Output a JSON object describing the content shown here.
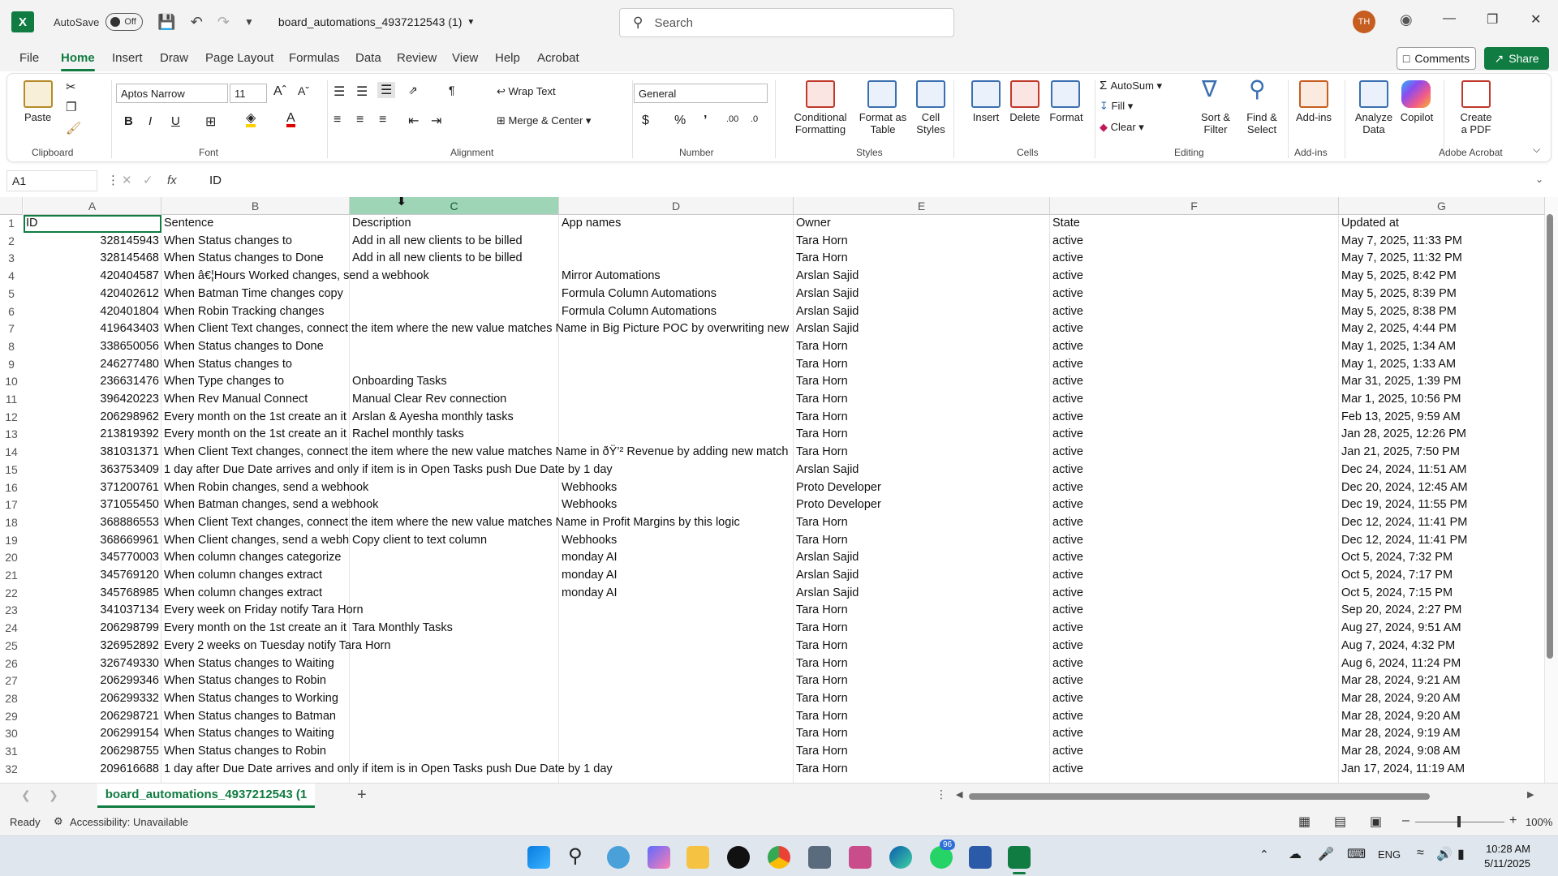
{
  "titlebar": {
    "app_icon": "excel-icon",
    "autosave_label": "AutoSave",
    "autosave_state": "Off",
    "file_title": "board_automations_4937212543 (1)",
    "search_placeholder": "Search",
    "avatar_initials": "TH"
  },
  "menu": {
    "tabs": [
      "File",
      "Home",
      "Insert",
      "Draw",
      "Page Layout",
      "Formulas",
      "Data",
      "Review",
      "View",
      "Help",
      "Acrobat"
    ],
    "active_tab": "Home",
    "comments_label": "Comments",
    "share_label": "Share"
  },
  "ribbon": {
    "clipboard": {
      "label": "Clipboard",
      "paste": "Paste"
    },
    "font": {
      "label": "Font",
      "family": "Aptos Narrow",
      "size": "11"
    },
    "alignment": {
      "label": "Alignment",
      "wrap_text": "Wrap Text",
      "merge_center": "Merge & Center"
    },
    "number": {
      "label": "Number",
      "format": "General"
    },
    "styles": {
      "label": "Styles",
      "conditional_1": "Conditional",
      "conditional_2": "Formatting",
      "format_as_1": "Format as",
      "format_as_2": "Table",
      "cell_styles_1": "Cell",
      "cell_styles_2": "Styles"
    },
    "cells": {
      "label": "Cells",
      "insert": "Insert",
      "delete": "Delete",
      "format": "Format"
    },
    "editing": {
      "label": "Editing",
      "autosum": "AutoSum",
      "fill": "Fill",
      "clear": "Clear",
      "sort_1": "Sort &",
      "sort_2": "Filter",
      "find_1": "Find &",
      "find_2": "Select"
    },
    "addins": {
      "label": "Add-ins",
      "addins": "Add-ins"
    },
    "analyze": {
      "analyze_1": "Analyze",
      "analyze_2": "Data",
      "copilot": "Copilot"
    },
    "acrobat": {
      "label": "Adobe Acrobat",
      "create_1": "Create",
      "create_2": "a PDF"
    }
  },
  "formula_bar": {
    "name_box": "A1",
    "fx": "fx",
    "content": "ID"
  },
  "columns": [
    "A",
    "B",
    "C",
    "D",
    "E",
    "F",
    "G"
  ],
  "rows": [
    [
      "ID",
      "Sentence",
      "Description",
      "App names",
      "Owner",
      "State",
      "Updated at"
    ],
    [
      "328145943",
      "When Status changes to",
      "Add in all new clients to be billed",
      "",
      "Tara Horn",
      "active",
      "May 7, 2025, 11:33 PM"
    ],
    [
      "328145468",
      "When Status changes to Done",
      "Add in all new clients to be billed",
      "",
      "Tara Horn",
      "active",
      "May 7, 2025, 11:32 PM"
    ],
    [
      "420404587",
      "When â€¦Hours Worked changes, send a webhook",
      "",
      "Mirror Automations",
      "Arslan Sajid",
      "active",
      "May 5, 2025, 8:42 PM"
    ],
    [
      "420402612",
      "When Batman Time changes copy",
      "",
      "Formula Column Automations",
      "Arslan Sajid",
      "active",
      "May 5, 2025, 8:39 PM"
    ],
    [
      "420401804",
      "When Robin Tracking changes",
      "",
      "Formula Column Automations",
      "Arslan Sajid",
      "active",
      "May 5, 2025, 8:38 PM"
    ],
    [
      "419643403",
      "When Client Text changes, connect the item where the new value matches Name in Big Picture POC by overwriting new",
      "",
      "",
      "Arslan Sajid",
      "active",
      "May 2, 2025, 4:44 PM"
    ],
    [
      "338650056",
      "When Status changes to Done",
      "",
      "",
      "Tara Horn",
      "active",
      "May 1, 2025, 1:34 AM"
    ],
    [
      "246277480",
      "When Status changes to",
      "",
      "",
      "Tara Horn",
      "active",
      "May 1, 2025, 1:33 AM"
    ],
    [
      "236631476",
      "When Type changes to",
      "Onboarding Tasks",
      "",
      "Tara Horn",
      "active",
      "Mar 31, 2025, 1:39 PM"
    ],
    [
      "396420223",
      "When Rev Manual Connect",
      "Manual Clear Rev connection",
      "",
      "Tara Horn",
      "active",
      "Mar 1, 2025, 10:56 PM"
    ],
    [
      "206298962",
      "Every month on the 1st create an it",
      "Arslan & Ayesha monthly tasks",
      "",
      "Tara Horn",
      "active",
      "Feb 13, 2025, 9:59 AM"
    ],
    [
      "213819392",
      "Every month on the 1st create an it",
      "Rachel monthly tasks",
      "",
      "Tara Horn",
      "active",
      "Jan 28, 2025, 12:26 PM"
    ],
    [
      "381031371",
      "When Client Text changes, connect the item where the new value matches Name in ðŸ’² Revenue by adding new match",
      "",
      "",
      "Tara Horn",
      "active",
      "Jan 21, 2025, 7:50 PM"
    ],
    [
      "363753409",
      "1 day after Due Date arrives and only if item is in Open Tasks push Due Date by 1 day",
      "",
      "",
      "Arslan Sajid",
      "active",
      "Dec 24, 2024, 11:51 AM"
    ],
    [
      "371200761",
      "When Robin changes, send a webhook",
      "",
      "Webhooks",
      "Proto Developer",
      "active",
      "Dec 20, 2024, 12:45 AM"
    ],
    [
      "371055450",
      "When Batman changes, send a webhook",
      "",
      "Webhooks",
      "Proto Developer",
      "active",
      "Dec 19, 2024, 11:55 PM"
    ],
    [
      "368886553",
      "When Client Text changes, connect the item where the new value matches Name in Profit Margins by this logic",
      "",
      "",
      "Tara Horn",
      "active",
      "Dec 12, 2024, 11:41 PM"
    ],
    [
      "368669961",
      "When Client changes, send a webh",
      "Copy client to text column",
      "Webhooks",
      "Tara Horn",
      "active",
      "Dec 12, 2024, 11:41 PM"
    ],
    [
      "345770003",
      "When column changes categorize",
      "",
      "monday AI",
      "Arslan Sajid",
      "active",
      "Oct 5, 2024, 7:32 PM"
    ],
    [
      "345769120",
      "When column changes extract",
      "",
      "monday AI",
      "Arslan Sajid",
      "active",
      "Oct 5, 2024, 7:17 PM"
    ],
    [
      "345768985",
      "When column changes extract",
      "",
      "monday AI",
      "Arslan Sajid",
      "active",
      "Oct 5, 2024, 7:15 PM"
    ],
    [
      "341037134",
      "Every week on Friday notify Tara Horn",
      "",
      "",
      "Tara Horn",
      "active",
      "Sep 20, 2024, 2:27 PM"
    ],
    [
      "206298799",
      "Every month on the 1st create an it",
      "Tara Monthly Tasks",
      "",
      "Tara Horn",
      "active",
      "Aug 27, 2024, 9:51 AM"
    ],
    [
      "326952892",
      "Every 2 weeks on Tuesday notify Tara Horn",
      "",
      "",
      "Tara Horn",
      "active",
      "Aug 7, 2024, 4:32 PM"
    ],
    [
      "326749330",
      "When Status changes to Waiting",
      "",
      "",
      "Tara Horn",
      "active",
      "Aug 6, 2024, 11:24 PM"
    ],
    [
      "206299346",
      "When Status changes to Robin",
      "",
      "",
      "Tara Horn",
      "active",
      "Mar 28, 2024, 9:21 AM"
    ],
    [
      "206299332",
      "When Status changes to Working",
      "",
      "",
      "Tara Horn",
      "active",
      "Mar 28, 2024, 9:20 AM"
    ],
    [
      "206298721",
      "When Status changes to Batman",
      "",
      "",
      "Tara Horn",
      "active",
      "Mar 28, 2024, 9:20 AM"
    ],
    [
      "206299154",
      "When Status changes to Waiting",
      "",
      "",
      "Tara Horn",
      "active",
      "Mar 28, 2024, 9:19 AM"
    ],
    [
      "206298755",
      "When Status changes to Robin",
      "",
      "",
      "Tara Horn",
      "active",
      "Mar 28, 2024, 9:08 AM"
    ],
    [
      "209616688",
      "1 day after Due Date arrives and only if item is in Open Tasks push Due Date by 1 day",
      "",
      "",
      "Tara Horn",
      "active",
      "Jan 17, 2024, 11:19 AM"
    ]
  ],
  "sheet_tab": "board_automations_4937212543 (1",
  "status": {
    "ready": "Ready",
    "accessibility": "Accessibility: Unavailable",
    "zoom": "100%"
  },
  "taskbar": {
    "lang": "ENG",
    "time": "10:28 AM",
    "date": "5/11/2025",
    "badge": "96"
  },
  "colors": {
    "accent": "#107c41",
    "selected_header": "#9fd5b7"
  }
}
